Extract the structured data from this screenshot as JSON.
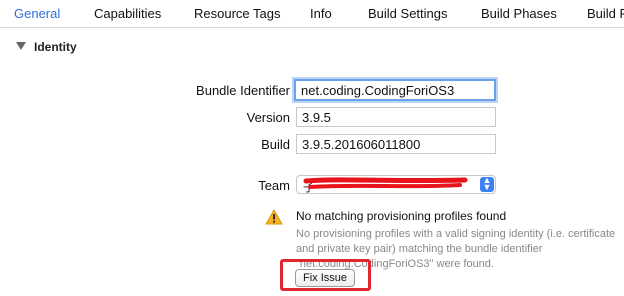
{
  "tabs": [
    {
      "label": "General",
      "active": true
    },
    {
      "label": "Capabilities",
      "active": false
    },
    {
      "label": "Resource Tags",
      "active": false
    },
    {
      "label": "Info",
      "active": false
    },
    {
      "label": "Build Settings",
      "active": false
    },
    {
      "label": "Build Phases",
      "active": false
    },
    {
      "label": "Build R",
      "active": false
    }
  ],
  "identity": {
    "section_title": "Identity",
    "bundle_identifier_label": "Bundle Identifier",
    "bundle_identifier_value": "net.coding.CodingForiOS3",
    "version_label": "Version",
    "version_value": "3.9.5",
    "build_label": "Build",
    "build_value": "3.9.5.201606011800",
    "team_label": "Team",
    "team_value": "子"
  },
  "warning": {
    "title": "No matching provisioning profiles found",
    "message": "No provisioning profiles with a valid signing identity (i.e. certificate and private key pair) matching the bundle identifier \"net.coding.CodingForiOS3\" were found.",
    "fix_button_label": "Fix Issue"
  },
  "colors": {
    "accent": "#2f6fd6",
    "highlight": "#e0262f",
    "redaction": "#e8141c"
  }
}
